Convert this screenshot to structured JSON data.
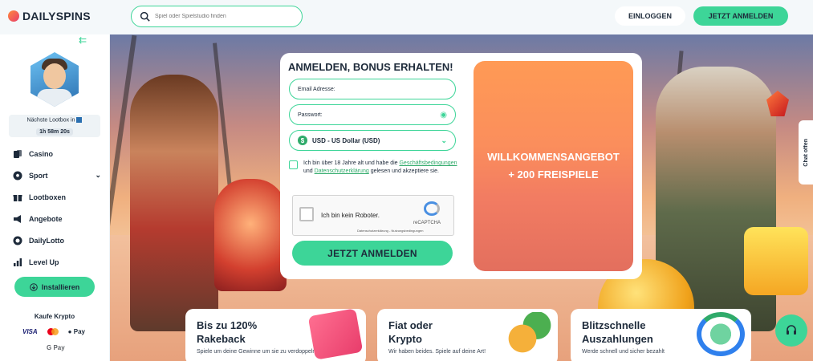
{
  "header": {
    "logo_text": "DAILYSPINS",
    "search_placeholder": "Spiel oder Spielstudio finden",
    "login_label": "EINLOGGEN",
    "register_label": "JETZT ANMELDEN"
  },
  "sidebar": {
    "lootbox_label": "Nächste Lootbox in",
    "lootbox_time": "1h 58m 20s",
    "items": [
      {
        "label": "Casino",
        "icon": "casino-icon"
      },
      {
        "label": "Sport",
        "icon": "soccer-ball-icon"
      },
      {
        "label": "Lootboxen",
        "icon": "gift-icon"
      },
      {
        "label": "Angebote",
        "icon": "megaphone-icon"
      },
      {
        "label": "DailyLotto",
        "icon": "lotto-ball-icon"
      },
      {
        "label": "Level Up",
        "icon": "bar-chart-icon"
      }
    ],
    "install_label": "Installieren",
    "krypto_label": "Kaufe Krypto",
    "payments": {
      "visa": "VISA",
      "applepay": " Pay",
      "gpay": "G Pay"
    }
  },
  "form": {
    "title": "ANMELDEN, BONUS ERHALTEN!",
    "email_placeholder": "Email Adresse:",
    "password_placeholder": "Passwort:",
    "currency_value": "USD - US Dollar (USD)",
    "terms_text_1": "Ich bin über 18 Jahre alt und habe die",
    "terms_link_1": "Geschäftsbedingungen",
    "terms_text_2": "und",
    "terms_link_2": "Datenschutzerklärung",
    "terms_text_3": "gelesen und akzeptiere sie.",
    "captcha_label": "Ich bin kein Roboter.",
    "captcha_brand": "reCAPTCHA",
    "captcha_legal": "Datenschutzerklärung - Nutzungsbedingungen",
    "submit_label": "JETZT ANMELDEN"
  },
  "promo": {
    "line1": "WILLKOMMENSANGEBOT",
    "line2": "+ 200 FREISPIELE"
  },
  "chat_tab": "Chat offen",
  "cards": [
    {
      "title_1": "Bis zu 120%",
      "title_2": "Rakeback",
      "subtitle": "Spiele um deine Gewinne um sie zu verdoppeln"
    },
    {
      "title_1": "Fiat oder",
      "title_2": "Krypto",
      "subtitle": "Wir haben beides. Spiele auf deine Art!"
    },
    {
      "title_1": "Blitzschnelle",
      "title_2": "Auszahlungen",
      "subtitle": "Werde schnell und sicher bezahlt"
    }
  ],
  "colors": {
    "accent": "#3dd598",
    "text": "#1d2a3a",
    "promo": "#fb8e5c"
  }
}
